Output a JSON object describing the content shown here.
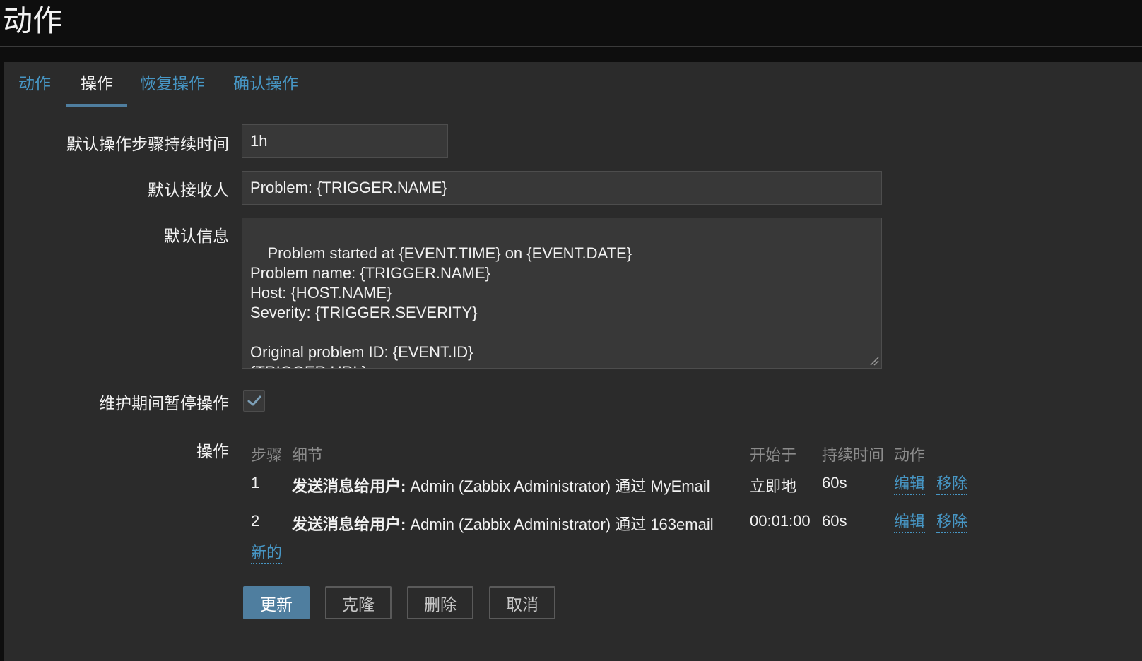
{
  "page": {
    "title": "动作"
  },
  "tabs": [
    {
      "label": "动作"
    },
    {
      "label": "操作"
    },
    {
      "label": "恢复操作"
    },
    {
      "label": "确认操作"
    }
  ],
  "form": {
    "default_step_duration": {
      "label": "默认操作步骤持续时间",
      "value": "1h"
    },
    "default_subject": {
      "label": "默认接收人",
      "value": "Problem: {TRIGGER.NAME}"
    },
    "default_message": {
      "label": "默认信息",
      "value": "Problem started at {EVENT.TIME} on {EVENT.DATE}\nProblem name: {TRIGGER.NAME}\nHost: {HOST.NAME}\nSeverity: {TRIGGER.SEVERITY}\n\nOriginal problem ID: {EVENT.ID}\n{TRIGGER.URL}"
    },
    "pause_in_maintenance": {
      "label": "维护期间暂停操作",
      "checked": true
    },
    "operations": {
      "label": "操作",
      "columns": {
        "steps": "步骤",
        "details": "细节",
        "start_in": "开始于",
        "duration": "持续时间",
        "action": "动作"
      },
      "rows": [
        {
          "step": "1",
          "details_bold": "发送消息给用户:",
          "details_rest": "Admin (Zabbix Administrator) 通过 MyEmail",
          "start_in": "立即地",
          "duration": "60s",
          "edit": "编辑",
          "remove": "移除"
        },
        {
          "step": "2",
          "details_bold": "发送消息给用户:",
          "details_rest": "Admin (Zabbix Administrator) 通过 163email",
          "start_in": "00:01:00",
          "duration": "60s",
          "edit": "编辑",
          "remove": "移除"
        }
      ],
      "new_link": "新的"
    }
  },
  "buttons": {
    "update": "更新",
    "clone": "克隆",
    "delete": "删除",
    "cancel": "取消"
  },
  "colors": {
    "link": "#4796c4",
    "accent": "#4f7e9f",
    "panel_bg": "#2b2b2b",
    "input_bg": "#383838"
  }
}
